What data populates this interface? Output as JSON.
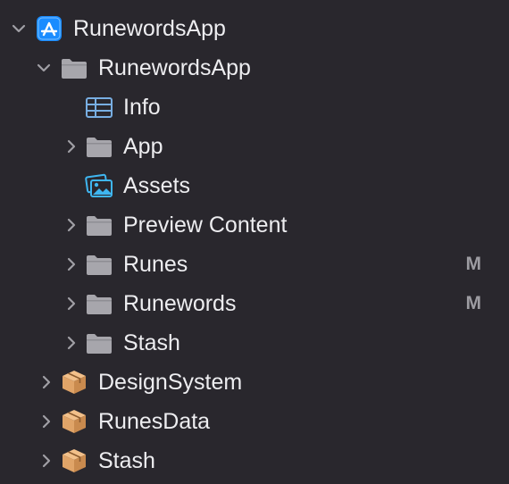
{
  "tree": {
    "items": [
      {
        "label": "RunewordsApp",
        "icon": "xcode-project-icon",
        "expanded": true
      },
      {
        "label": "RunewordsApp",
        "icon": "folder-icon",
        "expanded": true
      },
      {
        "label": "Info",
        "icon": "plist-table-icon"
      },
      {
        "label": "App",
        "icon": "folder-icon",
        "expanded": false
      },
      {
        "label": "Assets",
        "icon": "asset-catalog-icon"
      },
      {
        "label": "Preview Content",
        "icon": "folder-icon",
        "expanded": false
      },
      {
        "label": "Runes",
        "icon": "folder-icon",
        "expanded": false,
        "status": "M"
      },
      {
        "label": "Runewords",
        "icon": "folder-icon",
        "expanded": false,
        "status": "M"
      },
      {
        "label": "Stash",
        "icon": "folder-icon",
        "expanded": false
      },
      {
        "label": "DesignSystem",
        "icon": "swift-package-icon",
        "expanded": false
      },
      {
        "label": "RunesData",
        "icon": "swift-package-icon",
        "expanded": false
      },
      {
        "label": "Stash",
        "icon": "swift-package-icon",
        "expanded": false
      }
    ]
  },
  "colors": {
    "background": "#29272d",
    "text": "#ededf0",
    "chevron": "#a09fa5",
    "folder": "#a7a6ac",
    "status": "#9d9ca2",
    "project_icon": "#1a8cff",
    "package_icon": "#e0a468",
    "asset_icon": "#3fb6f0",
    "plist_icon": "#78aee2"
  }
}
